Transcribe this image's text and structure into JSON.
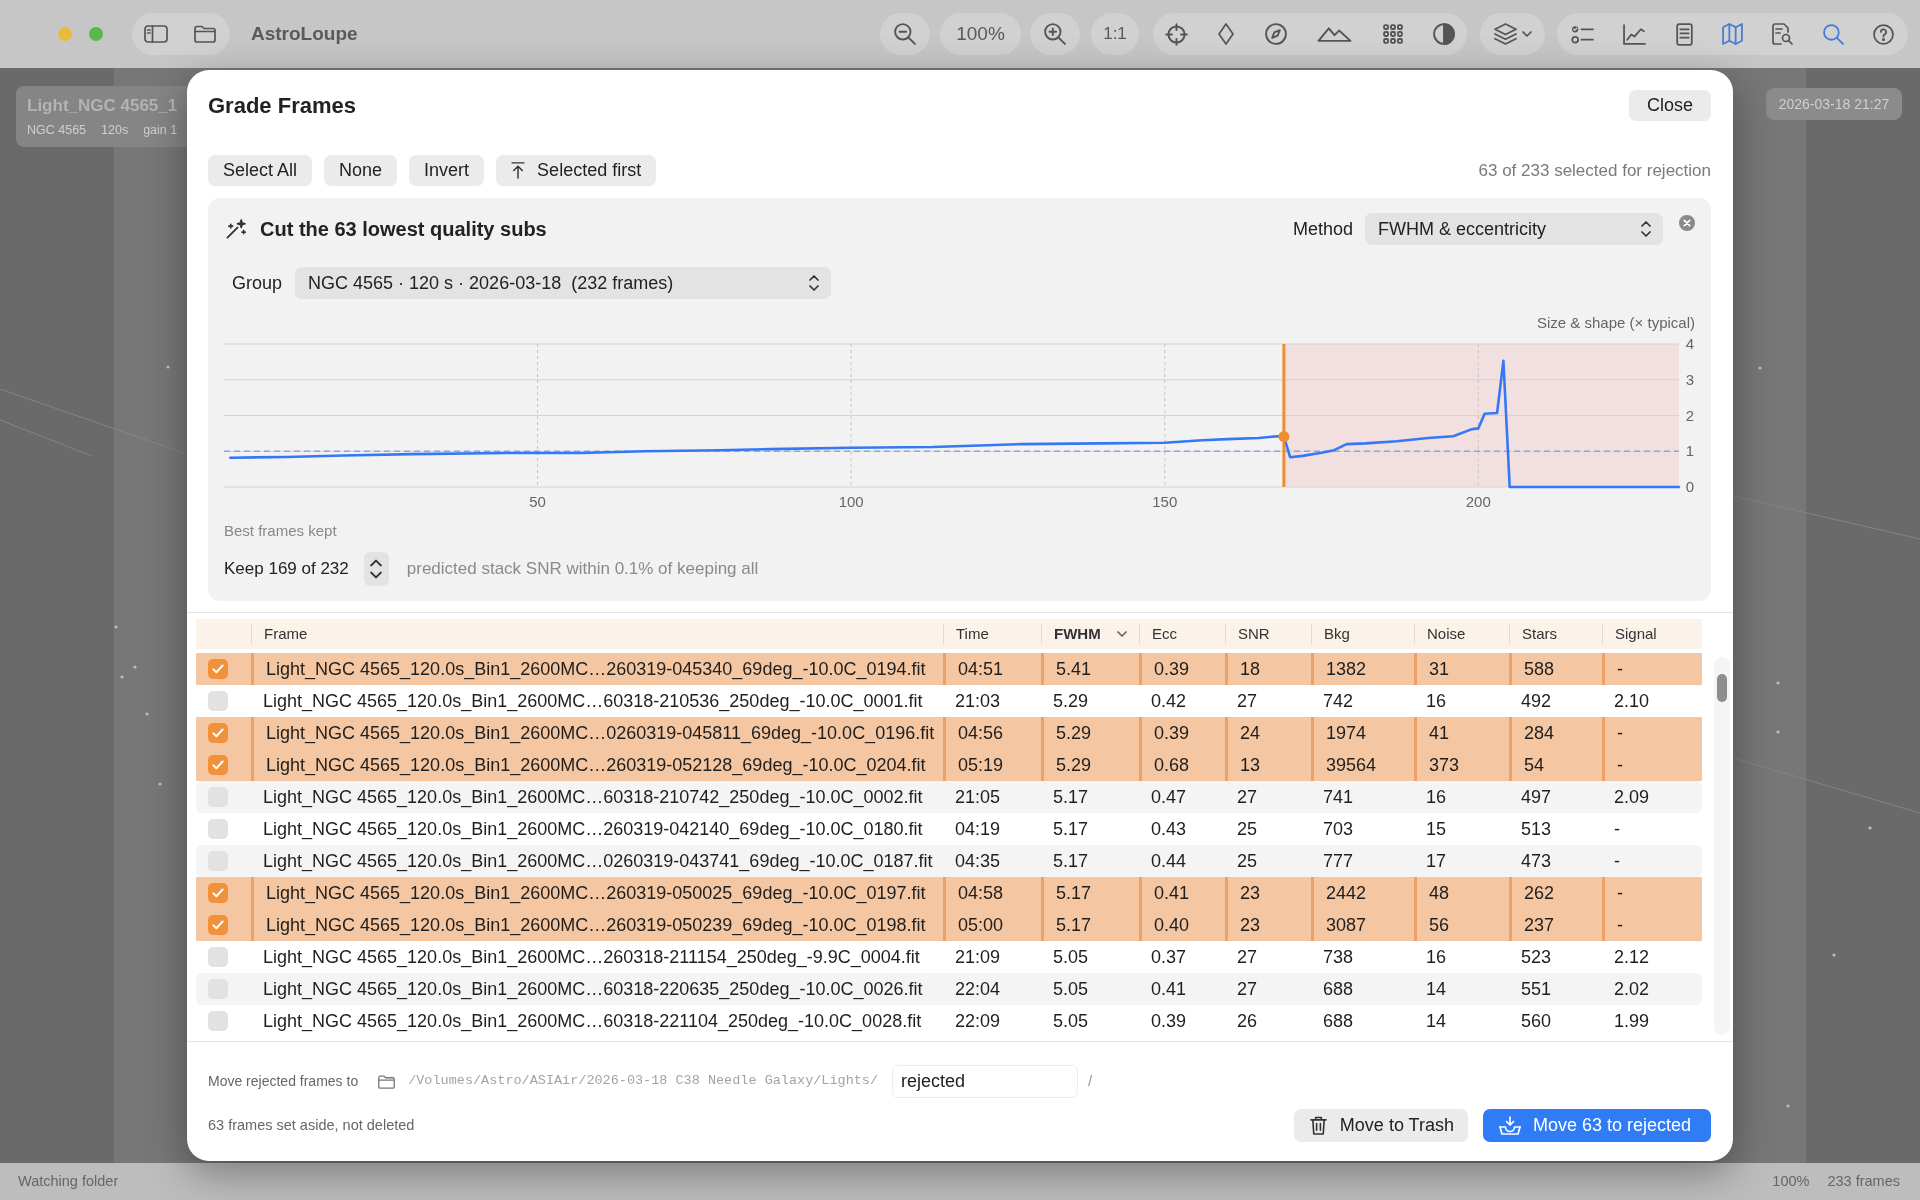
{
  "window": {
    "title": "AstroLoupe"
  },
  "toolbar": {
    "zoom": "100%",
    "actual_size": "1:1"
  },
  "image_overlay": {
    "title": "Light_NGC 4565_1",
    "details": [
      "NGC 4565",
      "120s",
      "gain 1"
    ],
    "timestamp": "2026-03-18 21:27"
  },
  "dialog": {
    "title": "Grade Frames",
    "close": "Close",
    "selection_buttons": [
      {
        "label": "Select All",
        "kind": "plain"
      },
      {
        "label": "None",
        "kind": "plain"
      },
      {
        "label": "Invert",
        "kind": "plain"
      },
      {
        "label": "Selected first",
        "kind": "move_to_top"
      }
    ],
    "selection_summary": "63 of 233 selected for rejection",
    "auto_cut": {
      "title": "Cut the 63 lowest quality subs",
      "method_label": "Method",
      "method": "FWHM & eccentricity",
      "group_label": "Group",
      "group": "NGC 4565 · 120 s · 2026-03-18  (232 frames)",
      "chart_data": {
        "type": "line",
        "xlabel": "Best frames kept",
        "ylabel": "Size & shape (× typical)",
        "xlim": [
          0,
          232
        ],
        "ylim": [
          0,
          4
        ],
        "xticks": [
          50,
          100,
          150,
          200
        ],
        "yticks": [
          0,
          1,
          2,
          3,
          4
        ],
        "grid": true,
        "x": [
          1,
          10,
          19,
          30,
          45,
          57,
          67,
          79,
          87,
          100,
          113,
          127,
          140,
          150,
          156,
          160,
          165,
          168,
          169,
          170,
          172,
          175,
          177,
          179,
          182,
          187,
          192,
          196,
          199,
          200,
          201,
          203,
          204,
          205,
          232
        ],
        "series": [
          {
            "color": "#3478f6",
            "values": [
              0.82,
              0.84,
              0.88,
              0.92,
              0.95,
              0.95,
              1.0,
              1.03,
              1.06,
              1.1,
              1.12,
              1.2,
              1.22,
              1.24,
              1.31,
              1.34,
              1.37,
              1.42,
              1.41,
              0.83,
              0.87,
              0.96,
              1.03,
              1.2,
              1.22,
              1.28,
              1.37,
              1.42,
              1.62,
              1.64,
              2.05,
              2.07,
              3.53,
              0,
              0
            ]
          }
        ],
        "ref_lines": [
          {
            "axis": "x",
            "value": 169,
            "color": "#ef8d33"
          },
          {
            "axis": "y",
            "value": 1,
            "color": "#8ea6e4"
          }
        ],
        "bands": [
          {
            "axis": "x",
            "from": 169,
            "to": 232,
            "color": "#f2e0e0"
          }
        ]
      },
      "keep": "Keep 169 of 232",
      "prediction": "predicted stack SNR within 0.1% of keeping all"
    },
    "table": {
      "columns": [
        {
          "label": "Frame",
          "sorted": false
        },
        {
          "label": "Time",
          "sorted": false
        },
        {
          "label": "FWHM",
          "sorted": true
        },
        {
          "label": "Ecc",
          "sorted": false
        },
        {
          "label": "SNR",
          "sorted": false
        },
        {
          "label": "Bkg",
          "sorted": false
        },
        {
          "label": "Noise",
          "sorted": false
        },
        {
          "label": "Stars",
          "sorted": false
        },
        {
          "label": "Signal",
          "sorted": false
        }
      ],
      "rows": [
        {
          "checked": true,
          "cells": [
            "Light_NGC 4565_120.0s_Bin1_2600MC…260319-045340_69deg_-10.0C_0194.fit",
            "04:51",
            "5.41",
            "0.39",
            "18",
            "1382",
            "31",
            "588",
            "-"
          ]
        },
        {
          "checked": false,
          "cells": [
            "Light_NGC 4565_120.0s_Bin1_2600MC…60318-210536_250deg_-10.0C_0001.fit",
            "21:03",
            "5.29",
            "0.42",
            "27",
            "742",
            "16",
            "492",
            "2.10"
          ]
        },
        {
          "checked": true,
          "cells": [
            "Light_NGC 4565_120.0s_Bin1_2600MC…0260319-045811_69deg_-10.0C_0196.fit",
            "04:56",
            "5.29",
            "0.39",
            "24",
            "1974",
            "41",
            "284",
            "-"
          ]
        },
        {
          "checked": true,
          "cells": [
            "Light_NGC 4565_120.0s_Bin1_2600MC…260319-052128_69deg_-10.0C_0204.fit",
            "05:19",
            "5.29",
            "0.68",
            "13",
            "39564",
            "373",
            "54",
            "-"
          ]
        },
        {
          "checked": false,
          "cells": [
            "Light_NGC 4565_120.0s_Bin1_2600MC…60318-210742_250deg_-10.0C_0002.fit",
            "21:05",
            "5.17",
            "0.47",
            "27",
            "741",
            "16",
            "497",
            "2.09"
          ]
        },
        {
          "checked": false,
          "cells": [
            "Light_NGC 4565_120.0s_Bin1_2600MC…260319-042140_69deg_-10.0C_0180.fit",
            "04:19",
            "5.17",
            "0.43",
            "25",
            "703",
            "15",
            "513",
            "-"
          ]
        },
        {
          "checked": false,
          "cells": [
            "Light_NGC 4565_120.0s_Bin1_2600MC…0260319-043741_69deg_-10.0C_0187.fit",
            "04:35",
            "5.17",
            "0.44",
            "25",
            "777",
            "17",
            "473",
            "-"
          ]
        },
        {
          "checked": true,
          "cells": [
            "Light_NGC 4565_120.0s_Bin1_2600MC…260319-050025_69deg_-10.0C_0197.fit",
            "04:58",
            "5.17",
            "0.41",
            "23",
            "2442",
            "48",
            "262",
            "-"
          ]
        },
        {
          "checked": true,
          "cells": [
            "Light_NGC 4565_120.0s_Bin1_2600MC…260319-050239_69deg_-10.0C_0198.fit",
            "05:00",
            "5.17",
            "0.40",
            "23",
            "3087",
            "56",
            "237",
            "-"
          ]
        },
        {
          "checked": false,
          "cells": [
            "Light_NGC 4565_120.0s_Bin1_2600MC…260318-211154_250deg_-9.9C_0004.fit",
            "21:09",
            "5.05",
            "0.37",
            "27",
            "738",
            "16",
            "523",
            "2.12"
          ]
        },
        {
          "checked": false,
          "cells": [
            "Light_NGC 4565_120.0s_Bin1_2600MC…60318-220635_250deg_-10.0C_0026.fit",
            "22:04",
            "5.05",
            "0.41",
            "27",
            "688",
            "14",
            "551",
            "2.02"
          ]
        },
        {
          "checked": false,
          "cells": [
            "Light_NGC 4565_120.0s_Bin1_2600MC…60318-221104_250deg_-10.0C_0028.fit",
            "22:09",
            "5.05",
            "0.39",
            "26",
            "688",
            "14",
            "560",
            "1.99"
          ]
        }
      ]
    },
    "footer": {
      "move_label": "Move rejected frames to",
      "path": "/Volumes/Astro/ASIAir/2026-03-18 C38 Needle Galaxy/Lights/",
      "folder_name": "rejected",
      "separator": "/",
      "note": "63 frames set aside, not deleted",
      "buttons": [
        {
          "label": "Move to Trash",
          "kind": "secondary"
        },
        {
          "label": "Move 63 to rejected",
          "kind": "primary"
        }
      ]
    }
  },
  "status_bar": {
    "text": "Watching folder",
    "zoom": "100%",
    "frames": "233 frames"
  }
}
